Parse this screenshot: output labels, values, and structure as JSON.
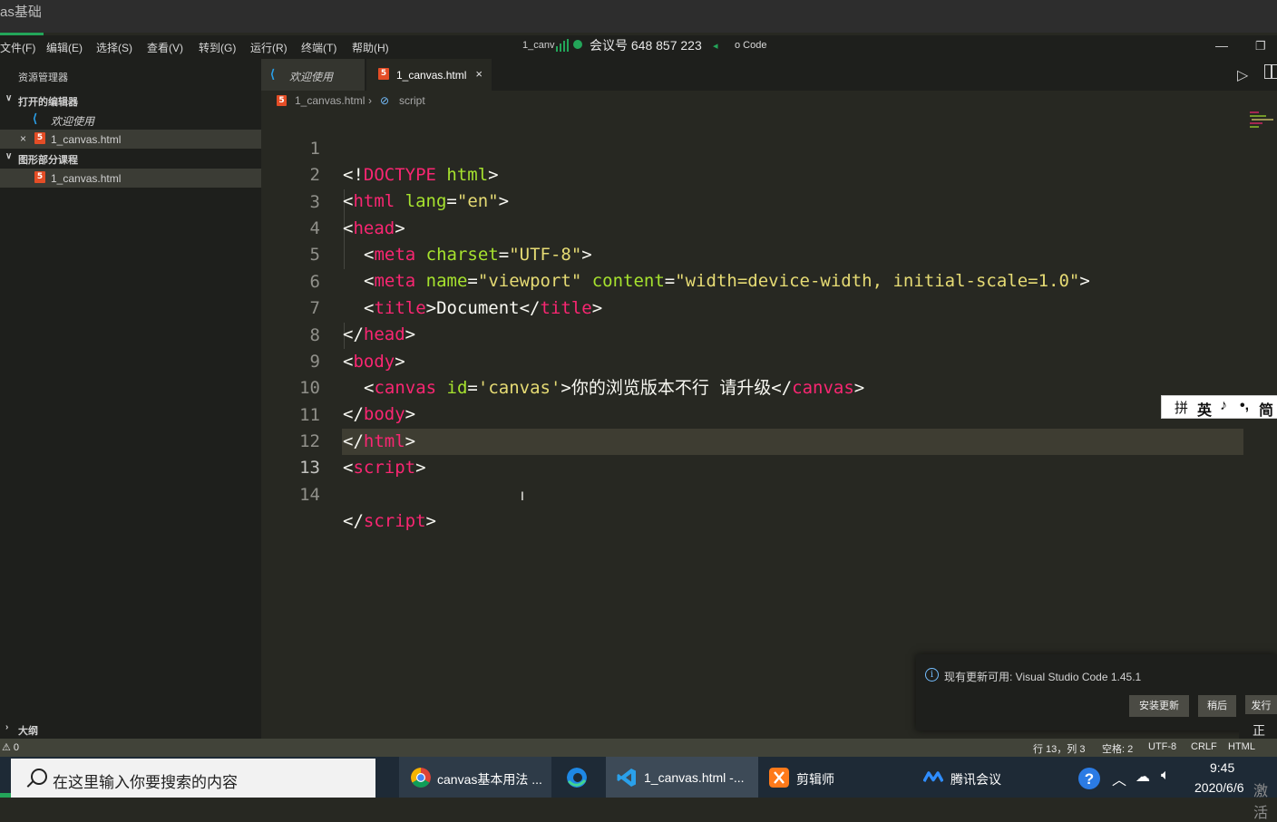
{
  "outer_window": {
    "title": "as基础"
  },
  "menubar": {
    "items": [
      "文件(F)",
      "编辑(E)",
      "选择(S)",
      "查看(V)",
      "转到(G)",
      "运行(R)",
      "终端(T)",
      "帮助(H)"
    ],
    "window_title_left": "1_canv",
    "window_title_right": "o Code",
    "meeting_id": "会议号 648 857 223"
  },
  "sidebar": {
    "title": "资源管理器",
    "open_editors": {
      "label": "打开的编辑器",
      "files": [
        "欢迎使用",
        "1_canvas.html"
      ]
    },
    "folder": {
      "label": "图形部分课程",
      "files": [
        "1_canvas.html"
      ]
    },
    "outline_label": "大纲"
  },
  "tabs": [
    {
      "label": "欢迎使用",
      "icon": "vscode-icon"
    },
    {
      "label": "1_canvas.html",
      "icon": "html5-icon",
      "close": "×"
    }
  ],
  "breadcrumb": {
    "file": "1_canvas.html",
    "separator": "›",
    "symbol": "script"
  },
  "editor": {
    "current_line": 13,
    "lines": [
      {
        "n": "1"
      },
      {
        "n": "2"
      },
      {
        "n": "3"
      },
      {
        "n": "4"
      },
      {
        "n": "5"
      },
      {
        "n": "6"
      },
      {
        "n": "7"
      },
      {
        "n": "8"
      },
      {
        "n": "9"
      },
      {
        "n": "10"
      },
      {
        "n": "11"
      },
      {
        "n": "12"
      },
      {
        "n": "13"
      },
      {
        "n": "14"
      }
    ],
    "tokens": {
      "l1_a": "<!",
      "l1_b": "DOCTYPE",
      "l1_c": " html",
      "l1_d": ">",
      "l2_a": "<",
      "l2_b": "html",
      "l2_c": " lang",
      "l2_d": "=",
      "l2_e": "\"en\"",
      "l2_f": ">",
      "l3_a": "<",
      "l3_b": "head",
      "l3_c": ">",
      "l4_a": "<",
      "l4_b": "meta",
      "l4_c": " charset",
      "l4_d": "=",
      "l4_e": "\"UTF-8\"",
      "l4_f": ">",
      "l5_a": "<",
      "l5_b": "meta",
      "l5_c": " name",
      "l5_d": "=",
      "l5_e": "\"viewport\"",
      "l5_f": " content",
      "l5_g": "=",
      "l5_h": "\"width=device-width, initial-scale=1.0\"",
      "l5_i": ">",
      "l6_a": "<",
      "l6_b": "title",
      "l6_c": ">Document</",
      "l6_d": "title",
      "l6_e": ">",
      "l7_a": "</",
      "l7_b": "head",
      "l7_c": ">",
      "l8_a": "<",
      "l8_b": "body",
      "l8_c": ">",
      "l9_a": "<",
      "l9_b": "canvas",
      "l9_c": " id",
      "l9_d": "=",
      "l9_e": "'canvas'",
      "l9_f": ">你的浏览版本不行 请升级</",
      "l9_g": "canvas",
      "l9_h": ">",
      "l10_a": "</",
      "l10_b": "body",
      "l10_c": ">",
      "l11_a": "</",
      "l11_b": "html",
      "l11_c": ">",
      "l12_a": "<",
      "l12_b": "script",
      "l12_c": ">",
      "l14_a": "</",
      "l14_b": "script",
      "l14_c": ">"
    },
    "text_cursor": "I"
  },
  "ime_bar": {
    "items": [
      "拼",
      "英",
      "♪",
      "•,",
      "简"
    ]
  },
  "notification": {
    "message": "现有更新可用: Visual Studio Code 1.45.1",
    "buttons": [
      "安装更新",
      "稍后",
      "发行"
    ],
    "partial_text": "正在"
  },
  "statusbar": {
    "problems": "⚠ 0",
    "position": "行 13，列 3",
    "spaces": "空格: 2",
    "encoding": "UTF-8",
    "eol": "CRLF",
    "language": "HTML"
  },
  "taskbar": {
    "search_placeholder": "在这里输入你要搜索的内容",
    "apps": [
      {
        "label": "canvas基本用法 ...",
        "icon": "chrome-icon"
      },
      {
        "label": "",
        "icon": "edge-icon"
      },
      {
        "label": "1_canvas.html -...",
        "icon": "vscode-icon"
      },
      {
        "label": "剪辑师",
        "icon": "video-editor-icon"
      },
      {
        "label": "腾讯会议",
        "icon": "tencent-meeting-icon"
      }
    ],
    "time": "9:45",
    "date": "2020/6/6",
    "watermark": "激活"
  },
  "colors": {
    "editor_bg": "#272822",
    "tag": "#f92672",
    "attribute": "#a6e22e",
    "string": "#e6db74",
    "accent_green": "#23a559"
  }
}
